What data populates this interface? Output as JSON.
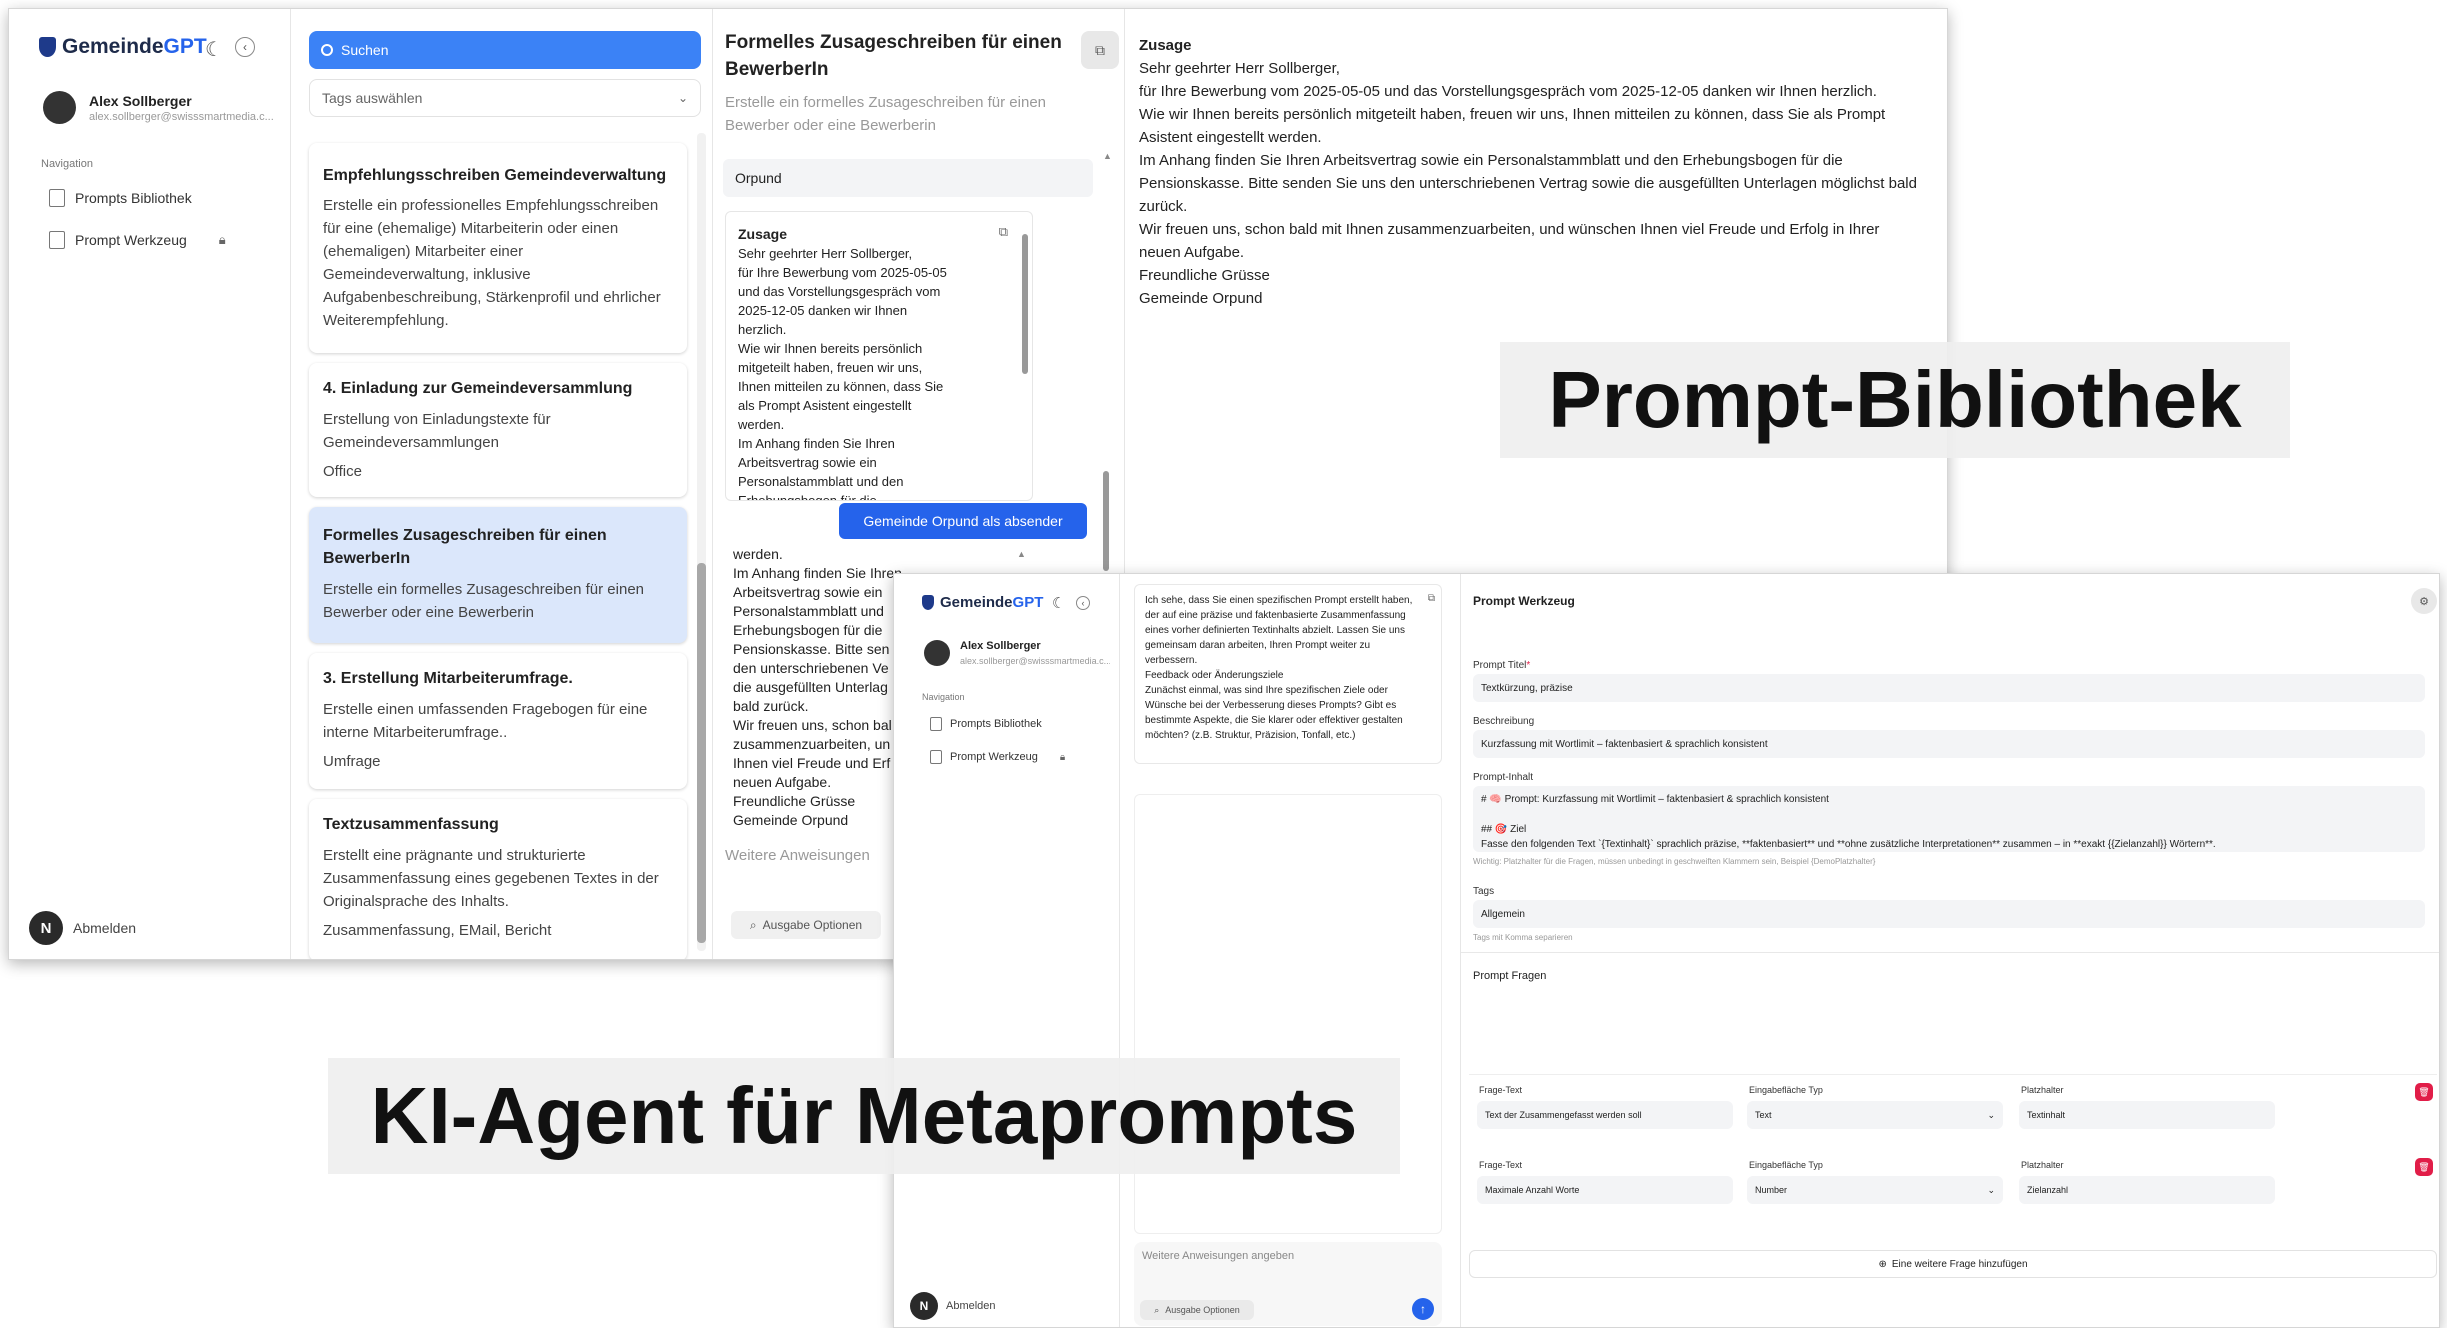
{
  "overlay_labels": {
    "library": "Prompt-Bibliothek",
    "agent": "KI-Agent für Metaprompts"
  },
  "app": {
    "logo_prefix": "Gemeinde",
    "logo_suffix": "GPT"
  },
  "user": {
    "name": "Alex Sollberger",
    "email": "alex.sollberger@swisssmartmedia.c...",
    "initial": "N"
  },
  "nav": {
    "section": "Navigation",
    "library": "Prompts Bibliothek",
    "editor": "Prompt Werkzeug",
    "logout": "Abmelden"
  },
  "list": {
    "search_placeholder": "Suchen",
    "tags_placeholder": "Tags auswählen",
    "cards": [
      {
        "title": "Empfehlungsschreiben Gemeindeverwaltung",
        "desc": "Erstelle ein professionelles Empfehlungsschreiben für eine (ehemalige) Mitarbeiterin oder einen (ehemaligen) Mitarbeiter einer Gemeindeverwaltung, inklusive Aufgabenbeschreibung, Stärkenprofil und ehrlicher Weiterempfehlung.",
        "tags": ""
      },
      {
        "title": "4. Einladung zur Gemeindeversammlung",
        "desc": "Erstellung von Einladungstexte für Gemeindeversammlungen",
        "tags": "Office"
      },
      {
        "title": "Formelles Zusageschreiben für einen BewerberIn",
        "desc": "Erstelle ein formelles Zusageschreiben für einen Bewerber oder eine Bewerberin",
        "tags": ""
      },
      {
        "title": "3. Erstellung Mitarbeiterumfrage.",
        "desc": "Erstelle einen umfassenden Fragebogen für eine interne Mitarbeiterumfrage..",
        "tags": "Umfrage"
      },
      {
        "title": "Textzusammenfassung",
        "desc": "Erstellt eine prägnante und strukturierte Zusammenfassung eines gegebenen Textes in der Originalsprache des Inhalts.",
        "tags": "Zusammenfassung, EMail, Bericht"
      }
    ]
  },
  "detail": {
    "title": "Formelles Zusageschreiben für einen BewerberIn",
    "subtitle": "Erstelle ein formelles Zusageschreiben für einen Bewerber oder eine Bewerberin",
    "field_value": "Orpund",
    "preview_title": "Zusage",
    "preview_body": "Sehr geehrter Herr Sollberger,\nfür Ihre Bewerbung vom 2025-05-05\nund das Vorstellungsgespräch vom\n2025-12-05 danken wir Ihnen\nherzlich.\nWie wir Ihnen bereits persönlich\nmitgeteilt haben, freuen wir uns,\nIhnen mitteilen zu können, dass Sie\nals Prompt Asistent eingestellt\nwerden.\nIm Anhang finden Sie Ihren\nArbeitsvertrag sowie ein\nPersonalstammblatt und den\nErhebungsbogen für die",
    "sender_button": "Gemeinde Orpund als absender",
    "second_body": "werden.\nIm Anhang finden Sie Ihren\nArbeitsvertrag sowie ein\nPersonalstammblatt und\nErhebungsbogen für die\nPensionskasse. Bitte sen\nden unterschriebenen Ve\ndie ausgefüllten Unterlag\nbald zurück.\nWir freuen uns, schon bal\nzusammenzuarbeiten, un\nIhnen viel Freude und Erf\nneuen Aufgabe.\nFreundliche Grüsse\nGemeinde Orpund",
    "further_placeholder": "Weitere Anweisungen",
    "output_options": "Ausgabe Optionen"
  },
  "output": {
    "title": "Zusage",
    "body": "Sehr geehrter Herr Sollberger,\nfür Ihre Bewerbung vom 2025-05-05 und das Vorstellungsgespräch vom 2025-12-05 danken wir Ihnen herzlich.\nWie wir Ihnen bereits persönlich mitgeteilt haben, freuen wir uns, Ihnen mitteilen zu können, dass Sie als Prompt Asistent eingestellt werden.\nIm Anhang finden Sie Ihren Arbeitsvertrag sowie ein Personalstammblatt und den Erhebungsbogen für die Pensionskasse. Bitte senden Sie uns den unterschriebenen Vertrag sowie die ausgefüllten Unterlagen möglichst bald zurück.\nWir freuen uns, schon bald mit Ihnen zusammenzuarbeiten, und wünschen Ihnen viel Freude und Erfolg in Ihrer neuen Aufgabe.\nFreundliche Grüsse\nGemeinde Orpund"
  },
  "chat": {
    "message": "Ich sehe, dass Sie einen spezifischen Prompt erstellt haben, der auf eine präzise und faktenbasierte Zusammenfassung eines vorher definierten Textinhalts abzielt. Lassen Sie uns gemeinsam daran arbeiten, Ihren Prompt weiter zu verbessern.\nFeedback oder Änderungsziele\nZunächst einmal, was sind Ihre spezifischen Ziele oder Wünsche bei der Verbesserung dieses Prompts? Gibt es bestimmte Aspekte, die Sie klarer oder effektiver gestalten möchten? (z.B. Struktur, Präzision, Tonfall, etc.)",
    "input_placeholder": "Weitere Anweisungen angeben",
    "output_options": "Ausgabe Optionen"
  },
  "editor": {
    "header": "Prompt Werkzeug",
    "title_label": "Prompt Titel",
    "required_mark": "*",
    "title_value": "Textkürzung, präzise",
    "desc_label": "Beschreibung",
    "desc_value": "Kurzfassung mit Wortlimit – faktenbasiert & sprachlich konsistent",
    "content_label": "Prompt-Inhalt",
    "content_value": "# 🧠 Prompt: Kurzfassung mit Wortlimit – faktenbasiert & sprachlich konsistent\n\n## 🎯 Ziel\nFasse den folgenden Text `{Textinhalt}` sprachlich präzise, **faktenbasiert** und **ohne zusätzliche Interpretationen** zusammen – in **exakt {{Zielanzahl}} Wörtern**.",
    "content_hint": "Wichtig: Platzhalter für die Fragen, müssen unbedingt in geschweiften Klammern sein, Beispiel {DemoPlatzhalter}",
    "tags_label": "Tags",
    "tags_value": "Allgemein",
    "tags_hint": "Tags mit Komma separieren",
    "questions_header": "Prompt Fragen",
    "col_question": "Frage-Text",
    "col_type": "Eingabefläche Typ",
    "col_placeholder": "Platzhalter",
    "questions": [
      {
        "text": "Text der Zusammengefasst werden soll",
        "type": "Text",
        "placeholder": "Textinhalt"
      },
      {
        "text": "Maximale Anzahl Worte",
        "type": "Number",
        "placeholder": "Zielanzahl"
      }
    ],
    "add_question": "Eine weitere Frage hinzufügen"
  }
}
